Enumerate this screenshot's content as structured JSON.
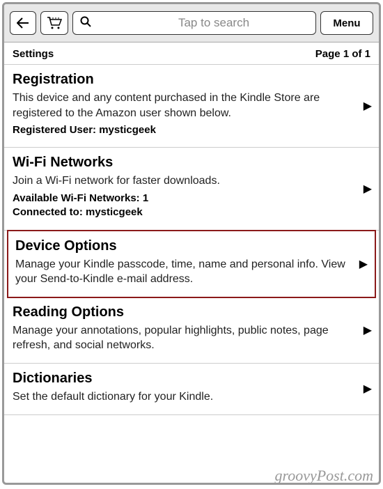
{
  "toolbar": {
    "search_placeholder": "Tap to search",
    "menu_label": "Menu"
  },
  "header": {
    "title": "Settings",
    "page_info": "Page 1 of 1"
  },
  "items": [
    {
      "title": "Registration",
      "desc": "This device and any content purchased in the Kindle Store are registered to the Amazon user shown below.",
      "meta1_label": "Registered User:",
      "meta1_value": "mysticgeek"
    },
    {
      "title": "Wi-Fi Networks",
      "desc": "Join a Wi-Fi network for faster downloads.",
      "meta1_label": "Available Wi-Fi Networks:",
      "meta1_value": "1",
      "meta2_label": "Connected to:",
      "meta2_value": "mysticgeek"
    },
    {
      "title": "Device Options",
      "desc": "Manage your Kindle passcode, time, name and personal info. View your Send-to-Kindle e-mail address."
    },
    {
      "title": "Reading Options",
      "desc": "Manage your annotations, popular highlights, public notes, page refresh, and social networks."
    },
    {
      "title": "Dictionaries",
      "desc": "Set the default dictionary for your Kindle."
    }
  ],
  "watermark": "groovyPost.com"
}
